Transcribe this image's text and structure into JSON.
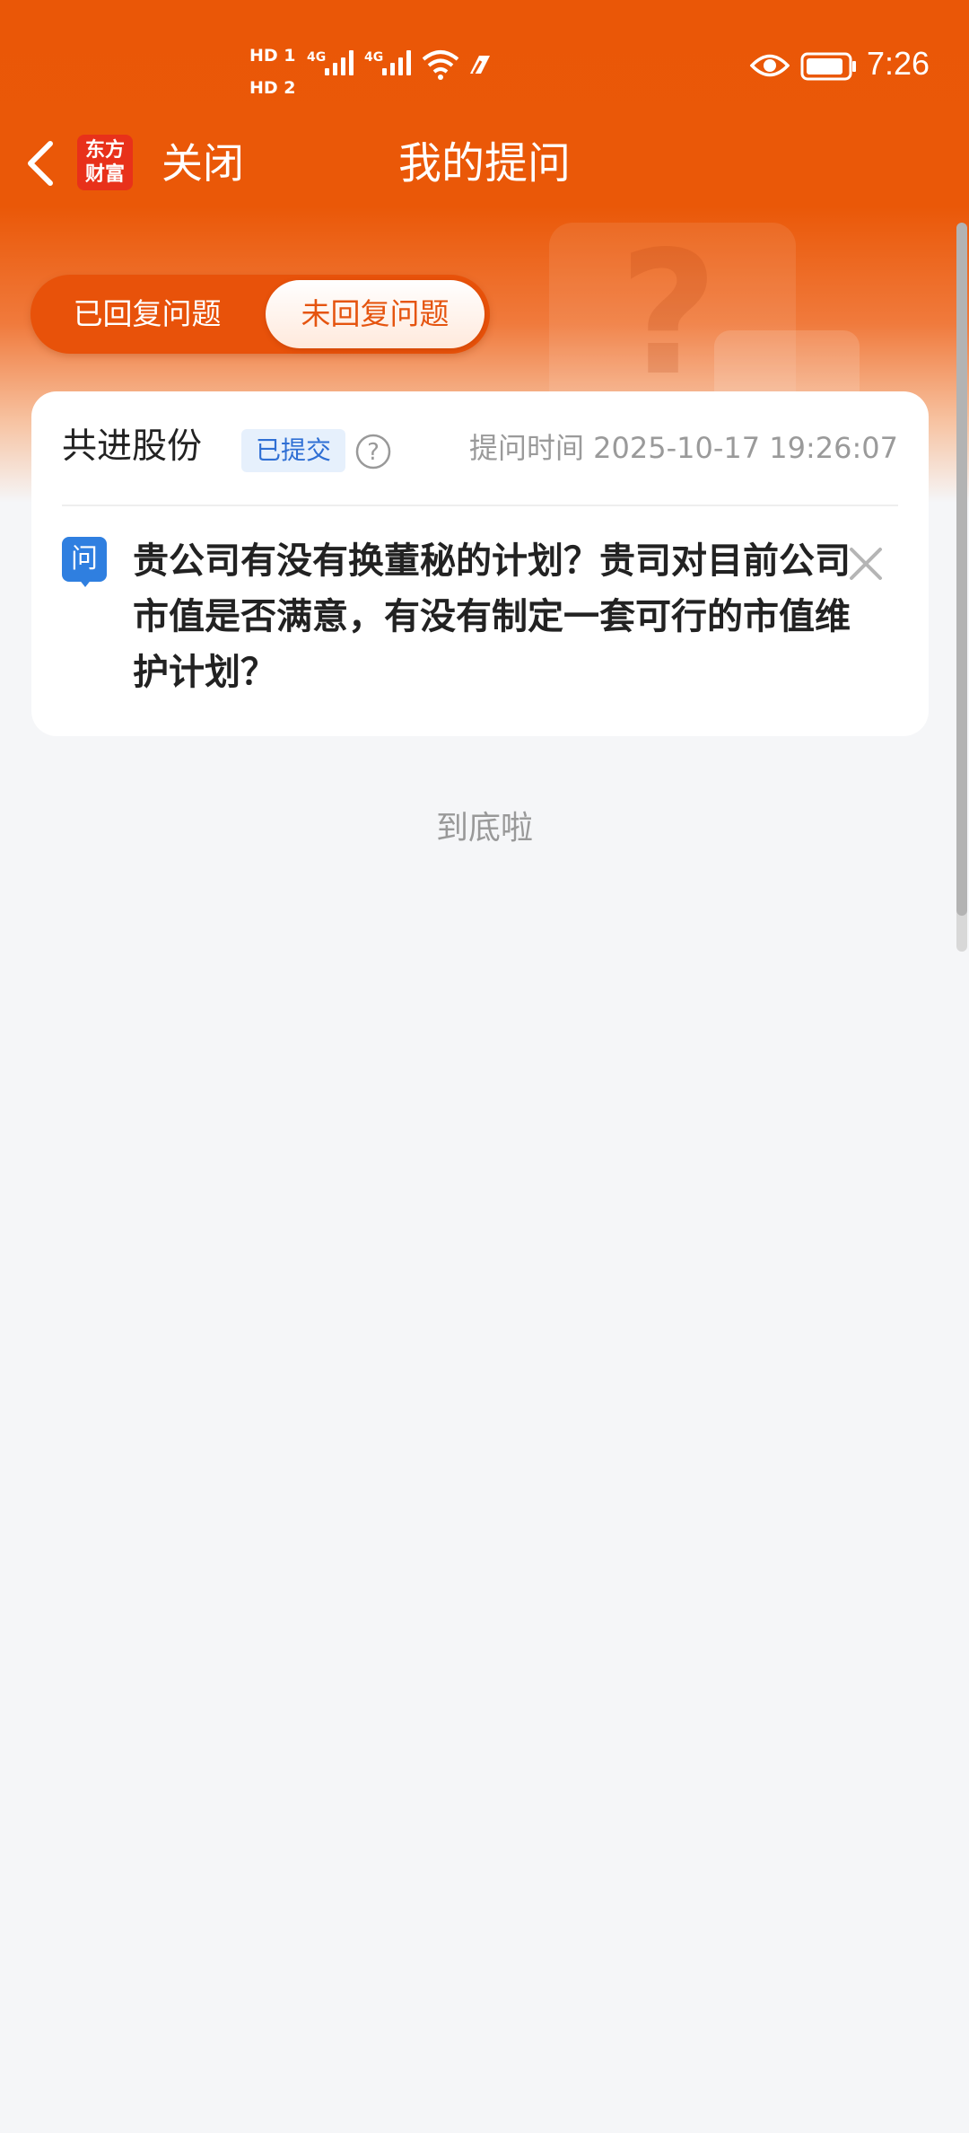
{
  "status_bar": {
    "hd1": "HD 1",
    "hd2": "HD 2",
    "net1": "4G",
    "net2": "4G",
    "time": "7:26"
  },
  "nav": {
    "logo_line1": "东方",
    "logo_line2": "财富",
    "close_label": "关闭",
    "title": "我的提问"
  },
  "tabs": [
    {
      "label": "已回复问题",
      "selected": false
    },
    {
      "label": "未回复问题",
      "selected": true
    }
  ],
  "question_card": {
    "stock_name": "共进股份",
    "status_badge": "已提交",
    "ask_time": "提问时间 2025-10-17 19:26:07",
    "question_icon": "问",
    "question_text": "贵公司有没有换董秘的计划？贵司对目前公司市值是否满意，有没有制定一套可行的市值维护计划？"
  },
  "end_text": "到底啦",
  "colors": {
    "brand_orange": "#ea5707",
    "badge_blue": "#2f6fd4",
    "question_icon_blue": "#2f7fe0"
  }
}
